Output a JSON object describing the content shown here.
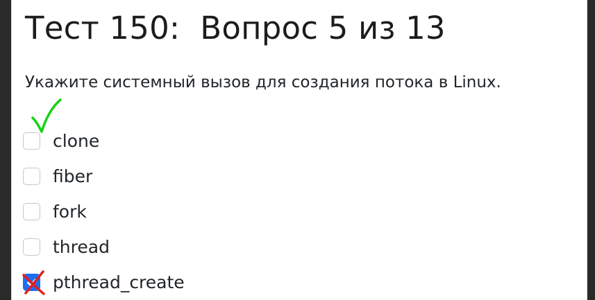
{
  "test": {
    "title": "Тест 150:  Вопрос 5 из 13",
    "question": "Укажите системный вызов для создания потока в Linux."
  },
  "answers": [
    {
      "label": "clone",
      "checked": false,
      "annotation": "correct-mark"
    },
    {
      "label": "fiber",
      "checked": false
    },
    {
      "label": "fork",
      "checked": false
    },
    {
      "label": "thread",
      "checked": false
    },
    {
      "label": "pthread_create",
      "checked": true,
      "annotation": "wrong-mark"
    }
  ],
  "colors": {
    "checkbox_checked": "#1b6ef3",
    "correct_mark": "#17d117",
    "wrong_mark": "#e02020"
  }
}
